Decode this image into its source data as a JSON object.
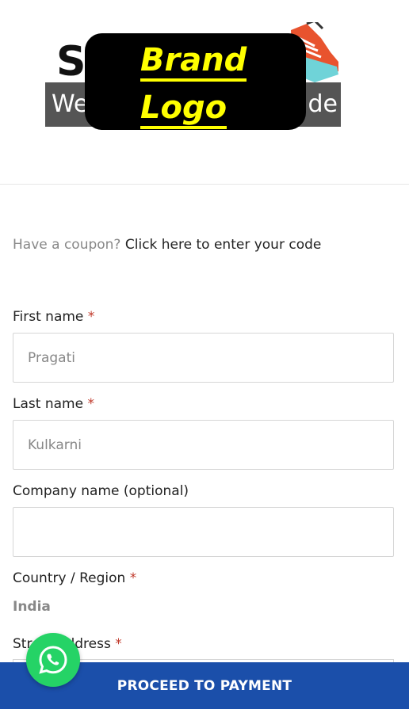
{
  "header": {
    "logo_left": "S",
    "logo_band_left": "We",
    "logo_band_right": "ide",
    "brand_line1": "Brand",
    "brand_line2": "Logo"
  },
  "coupon": {
    "question": "Have a coupon?",
    "link": "Click here to enter your code"
  },
  "form": {
    "first_name": {
      "label": "First name",
      "required": "*",
      "placeholder": "Pragati"
    },
    "last_name": {
      "label": "Last name",
      "required": "*",
      "placeholder": "Kulkarni"
    },
    "company": {
      "label": "Company name (optional)",
      "placeholder": ""
    },
    "country": {
      "label": "Country / Region",
      "required": "*",
      "value": "India"
    },
    "street": {
      "label": "Street address",
      "required": "*"
    }
  },
  "actions": {
    "proceed_label": "PROCEED TO PAYMENT"
  },
  "colors": {
    "accent": "#1b4faa",
    "brand_yellow": "#ffff00",
    "whatsapp": "#25d366",
    "required": "#c0392b"
  },
  "icons": {
    "whatsapp": "whatsapp-icon",
    "shoe": "shoe-icon"
  }
}
